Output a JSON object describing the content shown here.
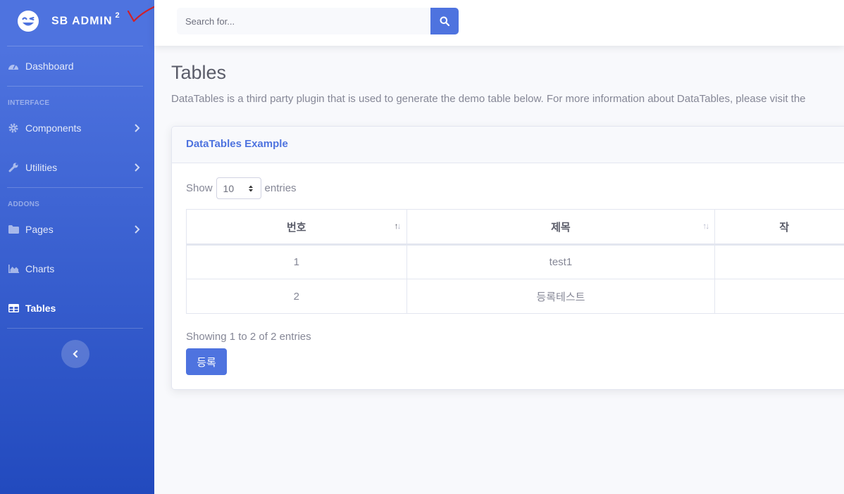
{
  "sidebar": {
    "brand": {
      "text": "SB ADMIN",
      "sup": "2"
    },
    "headings": {
      "interface": "INTERFACE",
      "addons": "ADDONS"
    },
    "items": {
      "dashboard": {
        "label": "Dashboard",
        "icon": "tachometer-icon"
      },
      "components": {
        "label": "Components",
        "icon": "gear-icon"
      },
      "utilities": {
        "label": "Utilities",
        "icon": "wrench-icon"
      },
      "pages": {
        "label": "Pages",
        "icon": "folder-icon"
      },
      "charts": {
        "label": "Charts",
        "icon": "chart-area-icon"
      },
      "tables": {
        "label": "Tables",
        "icon": "table-icon",
        "active": true
      }
    },
    "gradient": [
      "#4e73df",
      "#224abe"
    ]
  },
  "topbar": {
    "search_placeholder": "Search for..."
  },
  "page": {
    "title": "Tables",
    "description": "DataTables is a third party plugin that is used to generate the demo table below. For more information about DataTables, please visit the"
  },
  "card": {
    "title": "DataTables Example",
    "show_label": "Show",
    "entries_label": "entries",
    "page_size": "10",
    "columns": [
      "번호",
      "제목",
      "작"
    ],
    "rows": [
      [
        "1",
        "test1",
        ""
      ],
      [
        "2",
        "등록테스트",
        ""
      ]
    ],
    "info": "Showing 1 to 2 of 2 entries",
    "register_button": "등록"
  },
  "colors": {
    "primary": "#4e73df",
    "text": "#858796",
    "heading": "#5a5c69"
  }
}
